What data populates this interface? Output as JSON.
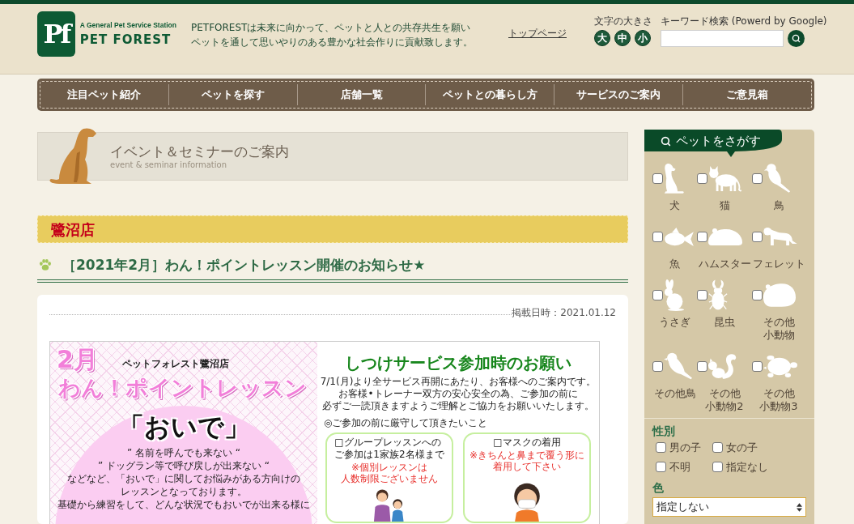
{
  "header": {
    "logo": {
      "mark": "Pf",
      "tagline": "A General Pet Service Station",
      "name": "PET FOREST"
    },
    "message": [
      "PETFORESTは未来に向かって、ペットと人との共存共生を願い",
      "ペットを通して思いやりのある豊かな社会作りに貢献致します。"
    ],
    "top_link": "トップページ",
    "font_size": {
      "label": "文字の大きさ",
      "buttons": [
        "大",
        "中",
        "小"
      ]
    },
    "search": {
      "label": "キーワード検索 (Powerd by Google)"
    }
  },
  "nav": [
    "注目ペット紹介",
    "ペットを探す",
    "店舗一覧",
    "ペットとの暮らし方",
    "サービスのご案内",
    "ご意見箱"
  ],
  "section_banner": {
    "title": "イベント＆セミナーのご案内",
    "subtitle": "event & seminar information"
  },
  "store_name": "鷺沼店",
  "article": {
    "title": "［2021年2月］わん！ポイントレッスン開催のお知らせ★",
    "posted": "掲載日時：2021.01.12",
    "flyer": {
      "left": {
        "month": "2月",
        "store": "ペットフォレスト鷺沼店",
        "title": "わん！ポイントレッスン",
        "keyword": "「おいで」",
        "body": [
          "” 名前を呼んでも来ない “",
          "” ドッグラン等で呼び戻しが出来ない “",
          "などなど、「おいで」に関してお悩みがある方向けの",
          "レッスンとなっております。",
          "基礎から練習をして、どんな状況でもおいでが出来る様に"
        ]
      },
      "right": {
        "title": "しつけサービス参加時のお願い",
        "intro": [
          "7/1(月)より全サービス再開にあたり、お客様へのご案内です。",
          "お客様•トレーナー双方の安心安全の為、ご参加の前に",
          "必ずご一読頂きますようご理解とご協力をお願いいたします。"
        ],
        "rules_heading": "◎ご参加の前に厳守して頂きたいこと",
        "rules": [
          {
            "kind": "group",
            "text": [
              "□グループレッスンへの",
              "ご参加は1家族2名様まで"
            ],
            "note": [
              "※個別レッスンは",
              "人数制限ございません"
            ]
          },
          {
            "kind": "mask",
            "text": [
              "□マスクの着用"
            ],
            "note": [
              "※きちんと鼻まで覆う形に着用して下さい"
            ]
          }
        ]
      }
    }
  },
  "sidebar": {
    "title": "ペットをさがす",
    "pets": [
      {
        "kind": "dog",
        "label": [
          "犬"
        ],
        "checked": false
      },
      {
        "kind": "cat",
        "label": [
          "猫"
        ],
        "checked": false
      },
      {
        "kind": "bird",
        "label": [
          "鳥"
        ],
        "checked": false
      },
      {
        "kind": "fish",
        "label": [
          "魚"
        ],
        "checked": false
      },
      {
        "kind": "hamster",
        "label": [
          "ハムスター"
        ],
        "checked": false
      },
      {
        "kind": "ferret",
        "label": [
          "フェレット"
        ],
        "checked": false
      },
      {
        "kind": "rabbit",
        "label": [
          "うさぎ"
        ],
        "checked": false
      },
      {
        "kind": "beetle",
        "label": [
          "昆虫"
        ],
        "checked": false
      },
      {
        "kind": "small_animal",
        "label": [
          "その他",
          "小動物"
        ],
        "checked": false
      },
      {
        "kind": "small_bird",
        "label": [
          "その他鳥"
        ],
        "checked": false
      },
      {
        "kind": "squirrel",
        "label": [
          "その他",
          "小動物2"
        ],
        "checked": false
      },
      {
        "kind": "turtle",
        "label": [
          "その他",
          "小動物3"
        ],
        "checked": false
      }
    ],
    "gender": {
      "heading": "性別",
      "options": [
        {
          "label": "男の子",
          "checked": false
        },
        {
          "label": "女の子",
          "checked": false
        },
        {
          "label": "不明",
          "checked": false
        },
        {
          "label": "指定なし",
          "checked": false
        }
      ]
    },
    "color": {
      "heading": "色",
      "select": {
        "value": "指定しない"
      }
    }
  }
}
